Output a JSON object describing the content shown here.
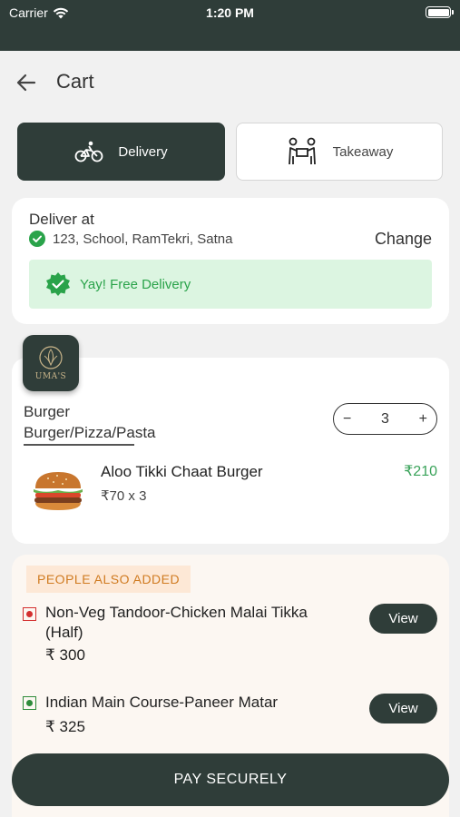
{
  "status_bar": {
    "carrier": "Carrier",
    "time": "1:20 PM"
  },
  "header": {
    "title": "Cart"
  },
  "modes": {
    "delivery": "Delivery",
    "takeaway": "Takeaway",
    "selected": "Delivery"
  },
  "address": {
    "label": "Deliver at",
    "value": "123, School, RamTekri, Satna",
    "change": "Change",
    "free_delivery": "Yay! Free Delivery"
  },
  "restaurant": {
    "logo_text": "UMA'S",
    "name": "Burger",
    "category": "Burger/Pizza/Pasta",
    "quantity": "3",
    "minus": "−",
    "plus": "+"
  },
  "cart_item": {
    "name": "Aloo Tikki Chaat Burger",
    "qty_price": "₹70 x 3",
    "total": "₹210"
  },
  "people_also_added": {
    "title": "PEOPLE ALSO ADDED",
    "items": [
      {
        "name": "Non-Veg Tandoor-Chicken Malai Tikka (Half)",
        "price": "₹ 300",
        "type": "non-veg",
        "action": "View"
      },
      {
        "name": "Indian Main Course-Paneer Matar",
        "price": "₹ 325",
        "type": "veg",
        "action": "View"
      }
    ]
  },
  "pay_button": "PAY SECURELY",
  "colors": {
    "primary": "#2f3d39",
    "accent_green": "#3aa35a",
    "badge_bg": "#fde8d6",
    "badge_text": "#d07b21"
  }
}
